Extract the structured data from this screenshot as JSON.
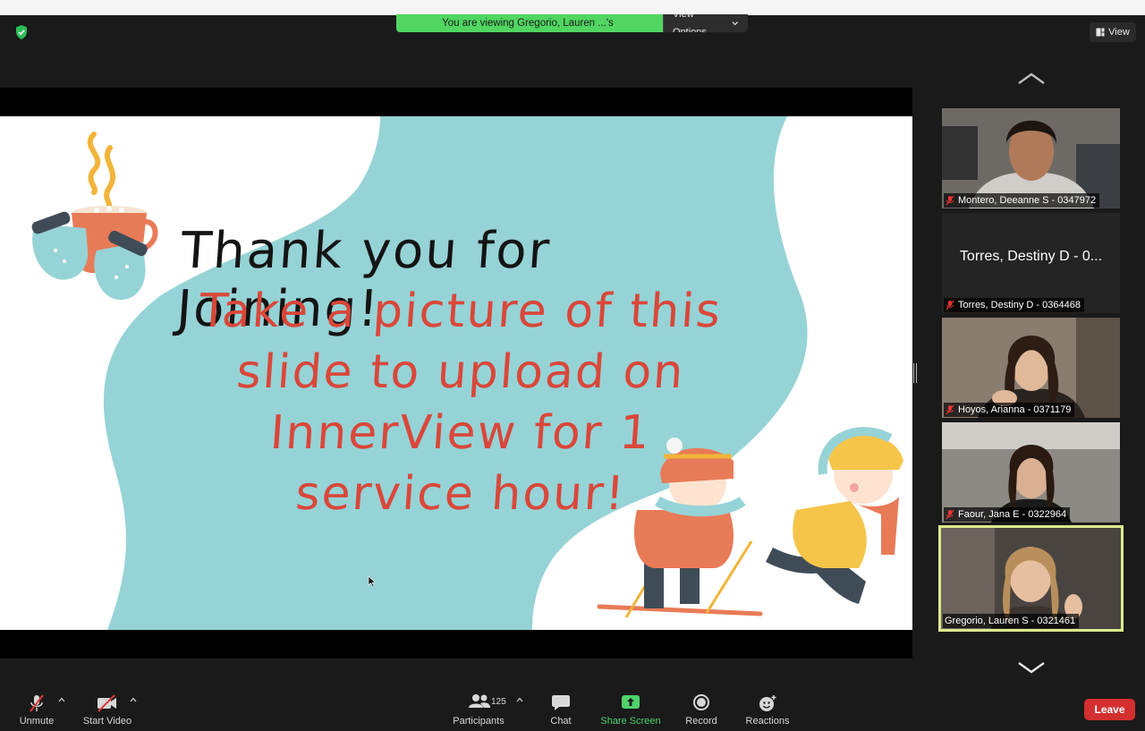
{
  "banner": {
    "message": "You are viewing Gregorio, Lauren ...'s screen",
    "view_options": "View Options"
  },
  "view_button": {
    "label": "View"
  },
  "slide": {
    "line1": "Thank you for Joining!",
    "line2": "Take a picture of this",
    "line3": "slide to upload on",
    "line4": "InnerView for 1",
    "line5": "service hour!"
  },
  "participants_gallery": [
    {
      "name": "Montero, Deeanne S - 0347972",
      "video": true,
      "muted": true
    },
    {
      "name": "Torres, Destiny D - 0364468",
      "big_name": "Torres, Destiny D - 0...",
      "video": false,
      "muted": true
    },
    {
      "name": "Hoyos, Arianna - 0371179",
      "video": true,
      "muted": true
    },
    {
      "name": "Faour, Jana E - 0322964",
      "video": true,
      "muted": true
    },
    {
      "name": "Gregorio, Lauren S - 0321461",
      "video": true,
      "muted": false,
      "active_speaker": true
    }
  ],
  "toolbar": {
    "unmute": "Unmute",
    "start_video": "Start Video",
    "participants": "Participants",
    "participants_count": "125",
    "chat": "Chat",
    "share_screen": "Share Screen",
    "record": "Record",
    "reactions": "Reactions",
    "leave": "Leave"
  },
  "colors": {
    "banner_green": "#51d661",
    "share_green": "#4fd26a",
    "leave_red": "#d32f2f",
    "active_outline": "#dcea8e",
    "slide_teal": "#96d3d6",
    "slide_red": "#d9473a"
  },
  "icons": [
    "shield-icon",
    "chevron-down-icon",
    "grid-icon",
    "chevron-up-icon",
    "microphone-muted-icon",
    "video-off-icon",
    "participants-icon",
    "chat-icon",
    "share-screen-icon",
    "record-icon",
    "reactions-icon"
  ]
}
